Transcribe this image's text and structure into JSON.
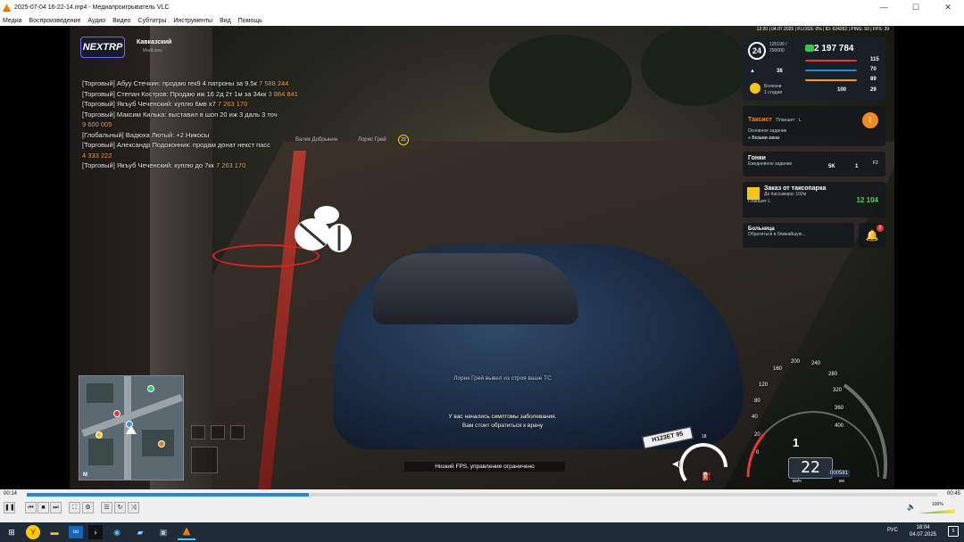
{
  "window": {
    "title": "2025-07-04 16-22-14.mp4 - Медиапроигрыватель VLC",
    "controls": [
      "—",
      "☐",
      "✕"
    ]
  },
  "menu": [
    "Медиа",
    "Воспроизведение",
    "Аудио",
    "Видео",
    "Субтитры",
    "Инструменты",
    "Вид",
    "Помощь"
  ],
  "game": {
    "logo": "NEXTRP",
    "server_name": "Кавказский",
    "server_sub": "MadLions",
    "top_stats": "12:20 | 04.07.2025 | P.LOSS: 0% | ID: 624262 | PING: 93 | FPS: 39",
    "chat": [
      {
        "text": "[Торговый] Абуу Стечкин: продаю гек9 4 патроны за 9.5к",
        "amount": "7 588 244"
      },
      {
        "text": "[Торговый] Степан Костров: Продаю иж 16 2д 2т 1м за 34кк",
        "amount": "3 884 841"
      },
      {
        "text": "[Торговый] Якъуб Чеченский: куплю 6мв х7",
        "amount": "7 263 170"
      },
      {
        "text": "[Торговый] Максим Килька: выставил в шоп 20 иж 3 даль 3 точ",
        "amount": "9 600 005"
      },
      {
        "text": "[Глобальный] Вадюха Лютый: +2 Никосы",
        "amount": ""
      },
      {
        "text": "[Торговый] Александр Подоконник: продам донат некст пасс",
        "amount": "4 333 222"
      },
      {
        "text": "[Торговый] Якъуб Чеченский: куплю до 7кк",
        "amount": "7 263 170"
      }
    ],
    "name_tag_1": "Валик Добрынин",
    "name_tag_2": "Лорис Грей",
    "name_tag_level": "22",
    "hud": {
      "level": "24",
      "xp": "120199 / 290000",
      "money": "2 197 784",
      "rank_stat": "38",
      "health": "115",
      "hunger": "70",
      "armor": "89",
      "ammo": "100",
      "wanted": "29",
      "disease_label": "Болезни",
      "disease_stage": "1 стадия"
    },
    "job_card": {
      "title": "Таксист",
      "tag": "Планшет",
      "key": "L",
      "sub": "Основное задание",
      "task": "Возьми заказ"
    },
    "race_card": {
      "title": "Гонки",
      "sub": "Ежедневное задание",
      "reward_money": "5K",
      "reward_coin": "1",
      "key": "F2"
    },
    "taxi_card": {
      "title": "Заказ от таксопарка",
      "sub": "До пассажира: 102м",
      "tag": "Планшет",
      "key": "L",
      "amount": "12 104"
    },
    "hospital_card": {
      "title": "Больница",
      "sub": "Обратиться в ближайшую...",
      "badge": "2"
    },
    "notices": {
      "kicked": "Лорик Грей вывел из строя ваше ТС",
      "disease_line1": "У вас начались симптомы заболевания.",
      "disease_line2": "Вам стоит обратиться к врачу",
      "fps_warning": "Низкий FPS, управление ограничено"
    },
    "plate": "Н123ЕТ 95",
    "speedo": {
      "ticks": [
        "0",
        "20",
        "40",
        "80",
        "120",
        "160",
        "200",
        "240",
        "280",
        "320",
        "360",
        "400"
      ],
      "gear": "1",
      "speed": "22",
      "unit": "км/ч",
      "odometer": "000581",
      "odometer_unit": "км",
      "fuel_label": "18"
    },
    "minimap_label": "M"
  },
  "player": {
    "time_current": "00:14",
    "time_total": "00:45",
    "progress": 0.31,
    "volume": "100%"
  },
  "taskbar": {
    "lang": "РУС",
    "clock": "18:04",
    "date": "04.07.2025",
    "notif_count": "5"
  }
}
